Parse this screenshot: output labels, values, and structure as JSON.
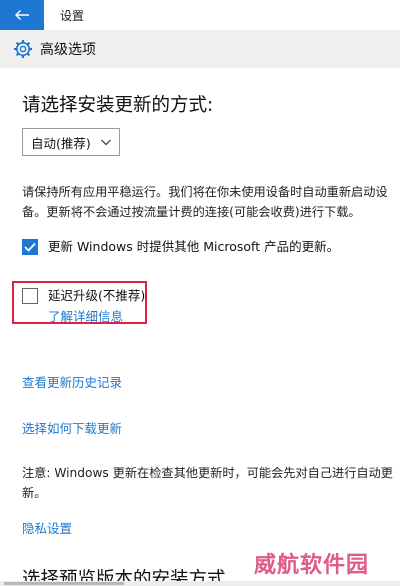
{
  "window": {
    "title": "设置"
  },
  "header": {
    "title": "高级选项",
    "icon": "gear-icon"
  },
  "install_section": {
    "heading": "请选择安装更新的方式:",
    "dropdown_value": "自动(推荐)",
    "description": "请保持所有应用平稳运行。我们将在你未使用设备时自动重新启动设备。更新将不会通过按流量计费的连接(可能会收费)进行下载。"
  },
  "options": {
    "microsoft_products_label": "更新 Windows 时提供其他 Microsoft 产品的更新。",
    "microsoft_products_checked": true,
    "defer_upgrade_label": "延迟升级(不推荐)",
    "defer_upgrade_checked": false,
    "learn_more_link": "了解详细信息"
  },
  "links": {
    "history": "查看更新历史记录",
    "delivery": "选择如何下载更新",
    "privacy": "隐私设置"
  },
  "note": "注意: Windows 更新在检查其他更新时，可能会先对自己进行自动更新。",
  "preview_heading": "选择预览版本的安装方式",
  "watermark": "威航软件园",
  "colors": {
    "accent": "#1e77d3",
    "highlight_box": "#d7263d",
    "header_bg": "#f0f0f0"
  }
}
